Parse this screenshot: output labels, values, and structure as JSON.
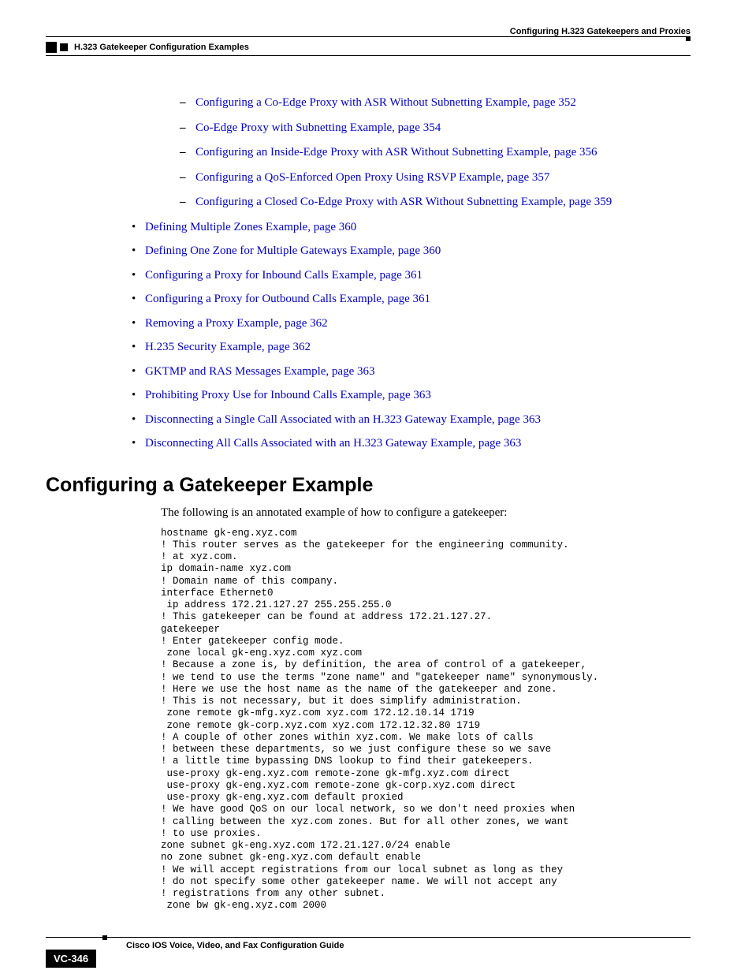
{
  "header": {
    "right": "Configuring H.323 Gatekeepers and Proxies",
    "left": "H.323 Gatekeeper Configuration Examples"
  },
  "links_dash": [
    "Configuring a Co-Edge Proxy with ASR Without Subnetting Example, page 352",
    "Co-Edge Proxy with Subnetting Example, page 354",
    "Configuring an Inside-Edge Proxy with ASR Without Subnetting Example, page 356",
    "Configuring a QoS-Enforced Open Proxy Using RSVP Example, page 357",
    "Configuring a Closed Co-Edge Proxy with ASR Without Subnetting Example, page 359"
  ],
  "links_dot": [
    "Defining Multiple Zones Example, page 360",
    "Defining One Zone for Multiple Gateways Example, page 360",
    "Configuring a Proxy for Inbound Calls Example, page 361",
    "Configuring a Proxy for Outbound Calls Example, page 361",
    "Removing a Proxy Example, page 362",
    "H.235 Security Example, page 362",
    "GKTMP and RAS Messages Example, page 363",
    "Prohibiting Proxy Use for Inbound Calls Example, page 363",
    "Disconnecting a Single Call Associated with an H.323 Gateway Example, page 363",
    "Disconnecting All Calls Associated with an H.323 Gateway Example, page 363"
  ],
  "section_heading": "Configuring a Gatekeeper Example",
  "section_intro": "The following is an annotated example of how to configure a gatekeeper:",
  "code": "hostname gk-eng.xyz.com\n! This router serves as the gatekeeper for the engineering community.\n! at xyz.com.\nip domain-name xyz.com\n! Domain name of this company.\ninterface Ethernet0\n ip address 172.21.127.27 255.255.255.0\n! This gatekeeper can be found at address 172.21.127.27.\ngatekeeper\n! Enter gatekeeper config mode.\n zone local gk-eng.xyz.com xyz.com\n! Because a zone is, by definition, the area of control of a gatekeeper,\n! we tend to use the terms \"zone name\" and \"gatekeeper name\" synonymously.\n! Here we use the host name as the name of the gatekeeper and zone.\n! This is not necessary, but it does simplify administration.\n zone remote gk-mfg.xyz.com xyz.com 172.12.10.14 1719\n zone remote gk-corp.xyz.com xyz.com 172.12.32.80 1719\n! A couple of other zones within xyz.com. We make lots of calls\n! between these departments, so we just configure these so we save\n! a little time bypassing DNS lookup to find their gatekeepers.\n use-proxy gk-eng.xyz.com remote-zone gk-mfg.xyz.com direct\n use-proxy gk-eng.xyz.com remote-zone gk-corp.xyz.com direct\n use-proxy gk-eng.xyz.com default proxied\n! We have good QoS on our local network, so we don't need proxies when\n! calling between the xyz.com zones. But for all other zones, we want\n! to use proxies.\nzone subnet gk-eng.xyz.com 172.21.127.0/24 enable\nno zone subnet gk-eng.xyz.com default enable\n! We will accept registrations from our local subnet as long as they\n! do not specify some other gatekeeper name. We will not accept any\n! registrations from any other subnet.\n zone bw gk-eng.xyz.com 2000",
  "footer": {
    "guide": "Cisco IOS Voice, Video, and Fax Configuration Guide",
    "page": "VC-346"
  }
}
